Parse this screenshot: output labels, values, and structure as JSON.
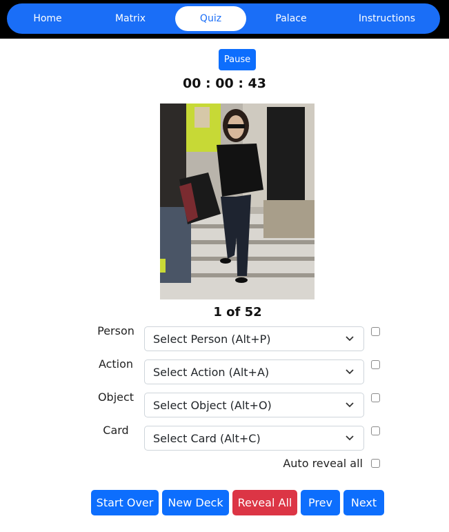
{
  "nav": {
    "items": [
      {
        "label": "Home"
      },
      {
        "label": "Matrix"
      },
      {
        "label": "Quiz",
        "active": true
      },
      {
        "label": "Palace"
      },
      {
        "label": "Instructions"
      }
    ]
  },
  "controls": {
    "pause_label": "Pause",
    "timer": "00 : 00 : 43"
  },
  "card": {
    "counter": "1 of 52"
  },
  "fields": [
    {
      "label": "Person",
      "placeholder": "Select Person (Alt+P)"
    },
    {
      "label": "Action",
      "placeholder": "Select Action (Alt+A)"
    },
    {
      "label": "Object",
      "placeholder": "Select Object (Alt+O)"
    },
    {
      "label": "Card",
      "placeholder": "Select Card (Alt+C)"
    }
  ],
  "auto_reveal": {
    "label": "Auto reveal all",
    "checked": false
  },
  "buttons": {
    "start_over": "Start Over",
    "new_deck": "New Deck",
    "reveal_all": "Reveal All",
    "prev": "Prev",
    "next": "Next"
  },
  "colors": {
    "primary": "#0d6efd",
    "nav_pill": "#1a6ef7",
    "danger": "#dc3545"
  }
}
